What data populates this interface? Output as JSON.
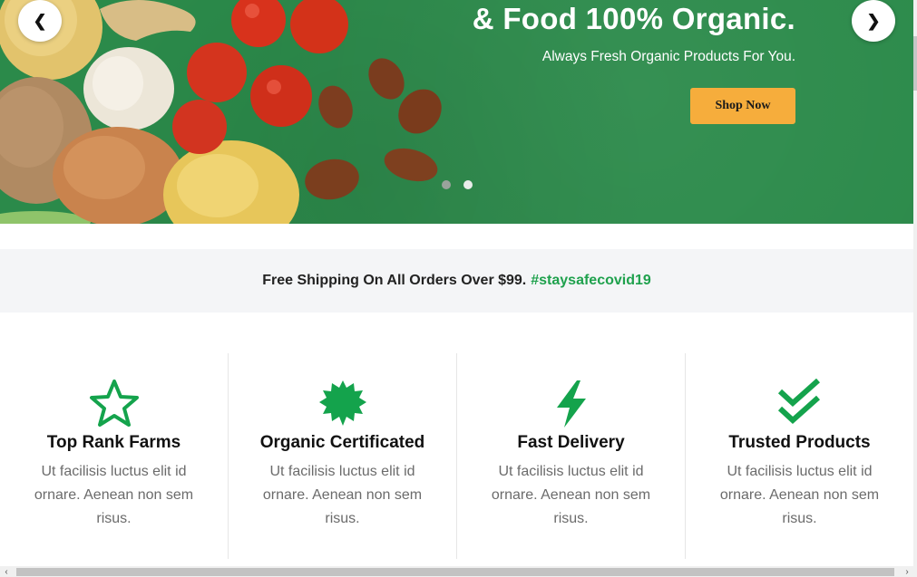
{
  "hero": {
    "title": "& Food 100% Organic.",
    "subtitle": "Always Fresh Organic Products For You.",
    "cta_label": "Shop Now",
    "prev_label": "❮",
    "next_label": "❯",
    "background_color": "#2b8a4a",
    "cta_color": "#f6ad3c"
  },
  "shipping": {
    "text": "Free Shipping On All Orders Over $99.",
    "hashtag": "#staysafecovid19",
    "hashtag_color": "#1fa14d"
  },
  "features": [
    {
      "icon": "star-icon",
      "title": "Top Rank Farms",
      "description": "Ut facilisis luctus elit id ornare. Aenean non sem risus."
    },
    {
      "icon": "certificate-badge-icon",
      "title": "Organic Certificated",
      "description": "Ut facilisis luctus elit id ornare. Aenean non sem risus."
    },
    {
      "icon": "lightning-bolt-icon",
      "title": "Fast Delivery",
      "description": "Ut facilisis luctus elit id ornare. Aenean non sem risus."
    },
    {
      "icon": "double-check-icon",
      "title": "Trusted Products",
      "description": "Ut facilisis luctus elit id ornare. Aenean non sem risus."
    }
  ],
  "accent_color": "#14a34c",
  "scrollbar": {
    "left_arrow": "‹",
    "right_arrow": "›"
  }
}
